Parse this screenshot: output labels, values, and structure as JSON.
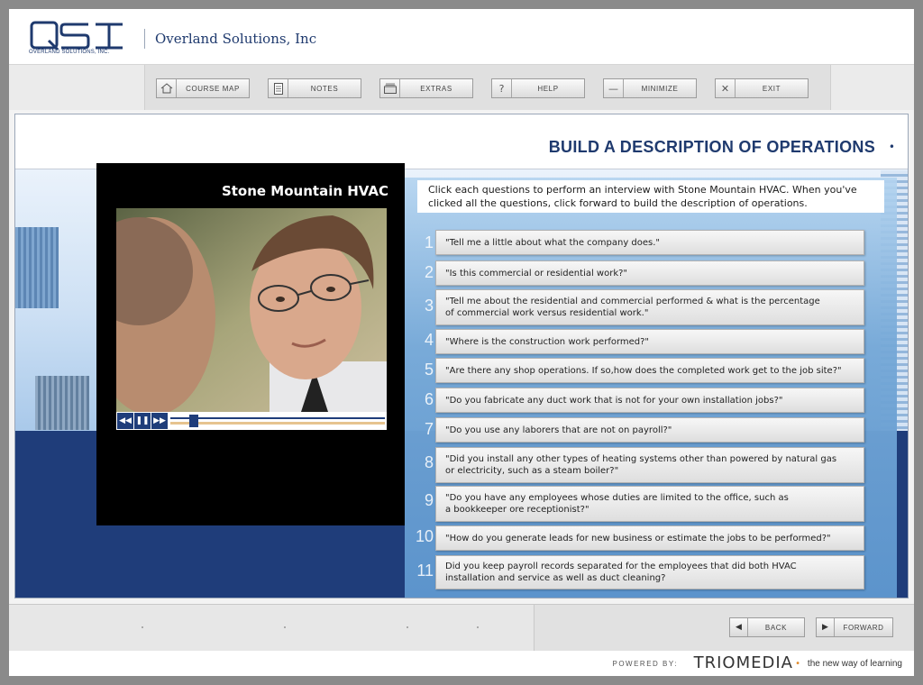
{
  "header": {
    "logo_text": "QSI",
    "logo_subtitle": "OVERLAND SOLUTIONS, INC.",
    "company_name": "Overland Solutions, Inc"
  },
  "toolbar": {
    "buttons": [
      {
        "label": "COURSE MAP",
        "icon": "home-icon"
      },
      {
        "label": "NOTES",
        "icon": "notes-icon"
      },
      {
        "label": "EXTRAS",
        "icon": "extras-icon"
      },
      {
        "label": "HELP",
        "icon": "help-icon"
      },
      {
        "label": "MINIMIZE",
        "icon": "minimize-icon"
      },
      {
        "label": "EXIT",
        "icon": "close-icon"
      }
    ]
  },
  "page": {
    "title": "BUILD A DESCRIPTION OF OPERATIONS",
    "title_bullet": "•",
    "instructions": "Click each questions to perform an interview with Stone Mountain HVAC. When you've clicked all the questions, click forward to build the description of operations."
  },
  "video": {
    "title": "Stone Mountain HVAC",
    "controls": [
      "rewind-icon",
      "pause-icon",
      "fast-forward-icon"
    ],
    "progress": 0.09
  },
  "questions": [
    {
      "num": "1",
      "text": "\"Tell me a little about what the company does.\""
    },
    {
      "num": "2",
      "text": "\"Is this commercial or residential work?\""
    },
    {
      "num": "3",
      "text": "\"Tell me about the residential and commercial performed & what is the percentage\n  of commercial work versus residential work.\""
    },
    {
      "num": "4",
      "text": "\"Where is the construction work performed?\""
    },
    {
      "num": "5",
      "text": "\"Are there any shop operations. If so,how does the completed work get to the job site?\""
    },
    {
      "num": "6",
      "text": "\"Do you fabricate any duct work that is not for your own installation  jobs?\""
    },
    {
      "num": "7",
      "text": "\"Do you use any laborers that are not on payroll?\""
    },
    {
      "num": "8",
      "text": "\"Did you install any other types of heating systems other than powered by natural gas\n  or electricity, such as a steam boiler?\""
    },
    {
      "num": "9",
      "text": "\"Do you have any employees whose duties are limited to the office, such as\n  a bookkeeper ore receptionist?\""
    },
    {
      "num": "10",
      "text": "\"How do you generate leads for new business or estimate the jobs to be performed?\""
    },
    {
      "num": "11",
      "text": "Did you keep payroll records separated for the employees that did both HVAC\ninstallation and service as well as duct cleaning?"
    }
  ],
  "nav": {
    "back_label": "BACK",
    "forward_label": "FORWARD"
  },
  "footer": {
    "powered_label": "POWERED BY:",
    "brand": "TRIOMEDIA",
    "tagline": "the new way of learning"
  }
}
